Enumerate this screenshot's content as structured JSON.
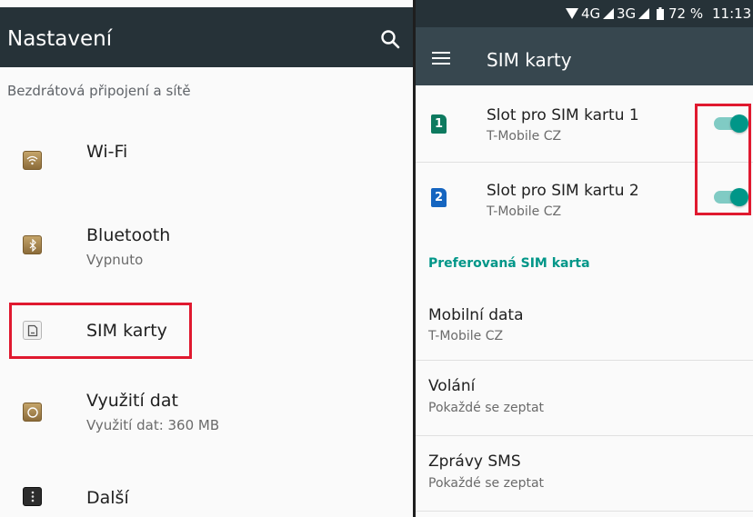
{
  "left_panel": {
    "title": "Nastavení",
    "search_icon": "search-icon",
    "section_header": "Bezdrátová připojení a sítě",
    "items": [
      {
        "icon": "wifi-icon",
        "label": "Wi-Fi",
        "subtitle": ""
      },
      {
        "icon": "bluetooth-icon",
        "label": "Bluetooth",
        "subtitle": "Vypnuto"
      },
      {
        "icon": "sim-card-icon",
        "label": "SIM karty",
        "subtitle": "",
        "highlighted": true
      },
      {
        "icon": "data-usage-icon",
        "label": "Využití dat",
        "subtitle": "Využití dat: 360 MB"
      },
      {
        "icon": "more-icon",
        "label": "Další",
        "subtitle": ""
      }
    ]
  },
  "status_bar": {
    "network_4g": "4G",
    "network_3g": "3G",
    "battery": "72 %",
    "time": "11:13"
  },
  "right_panel": {
    "title": "SIM karty",
    "menu_icon": "hamburger-menu-icon",
    "sim_slots": [
      {
        "badge": "1",
        "label": "Slot pro SIM kartu 1",
        "operator": "T-Mobile CZ",
        "enabled": true
      },
      {
        "badge": "2",
        "label": "Slot pro SIM kartu 2",
        "operator": "T-Mobile CZ",
        "enabled": true
      }
    ],
    "preferred_header": "Preferovaná SIM karta",
    "preferences": [
      {
        "label": "Mobilní data",
        "value": "T-Mobile CZ"
      },
      {
        "label": "Volání",
        "value": "Pokaždé se zeptat"
      },
      {
        "label": "Zprávy SMS",
        "value": "Pokaždé se zeptat"
      }
    ]
  },
  "colors": {
    "accent": "#009688",
    "appbar_left": "#263238",
    "appbar_right": "#37474f",
    "highlight": "#e0192f"
  }
}
